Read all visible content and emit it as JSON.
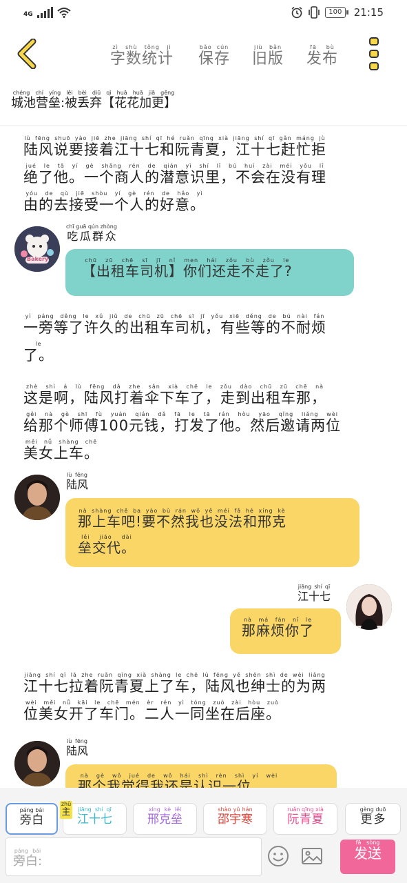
{
  "status_bar": {
    "network": "4G",
    "battery": "100",
    "time": "21:15"
  },
  "toolbar": {
    "items": [
      {
        "label": "字数统计",
        "pinyin": "zì shù tǒng jì"
      },
      {
        "label": "保存",
        "pinyin": "bǎo cún"
      },
      {
        "label": "旧版",
        "pinyin": "jiù bǎn"
      },
      {
        "label": "发布",
        "pinyin": "fā bù"
      }
    ]
  },
  "story": {
    "title": "城池营垒:被丢弃【花花加更】",
    "title_pinyin": "chéng chí yíng lěi   bèi diū qì    huā huā jiā gēng"
  },
  "messages": [
    {
      "type": "narration",
      "lines": [
        {
          "text": "陆风说要接着江十七和阮青夏，江十七赶忙拒",
          "pinyin": "lù fēng shuō yào jiē zhe jiāng shí qī hé ruǎn qīng xià  jiāng shí qī gǎn máng jù"
        },
        {
          "text": "绝了他。一个商人的潜意识里，不会在没有理",
          "pinyin": "jué le tā  yí gè shāng rén de qián yì shí lǐ  bú huì zài méi yǒu lǐ"
        },
        {
          "text": "由的去接受一个人的好意。",
          "pinyin": "yóu de qù jiē shòu yí gè rén de hǎo yì"
        }
      ]
    },
    {
      "type": "dialog",
      "side": "left",
      "speaker": "吃瓜群众",
      "speaker_pinyin": "chī guā qún zhòng",
      "color": "#7fd3cb",
      "lines": [
        {
          "text": "【出租车司机】你们还走不走了?",
          "pinyin": "chū zū chē sī jī  nǐ men hái zǒu bù zǒu le"
        }
      ]
    },
    {
      "type": "narration",
      "lines": [
        {
          "text": "一旁等了许久的出租车司机，有些等的不耐烦",
          "pinyin": "yì páng děng le xǔ jiǔ de chū zū chē sī jī  yǒu xiē děng de bú nài fán"
        },
        {
          "text": "了。",
          "pinyin": "le"
        }
      ]
    },
    {
      "type": "narration",
      "lines": [
        {
          "text": "这是啊，陆风打着伞下车了，走到出租车那，",
          "pinyin": "zhè shì á  lù fēng dǎ zhe sǎn xià chē le  zǒu dào chū zū chē nà"
        },
        {
          "text": "给那个师傅100元钱，打发了他。然后邀请两位",
          "pinyin": "gěi nà gè shī fù   yuán qián  dǎ fā le tā  rán hòu yāo qǐng liǎng wèi"
        },
        {
          "text": "美女上车。",
          "pinyin": "měi nǚ shàng chē"
        }
      ]
    },
    {
      "type": "dialog",
      "side": "left",
      "speaker": "陆风",
      "speaker_pinyin": "lù fēng",
      "color": "#fad667",
      "lines": [
        {
          "text": "那上车吧!要不然我也没法和邢克",
          "pinyin": "nà shàng chē ba  yào bù rán wǒ yě méi fǎ hé xíng kè"
        },
        {
          "text": "垒交代。",
          "pinyin": "lěi jiāo dài"
        }
      ]
    },
    {
      "type": "dialog",
      "side": "right",
      "speaker": "江十七",
      "speaker_pinyin": "jiāng shí qī",
      "color": "#fad667",
      "lines": [
        {
          "text": "那麻烦你了",
          "pinyin": "nà má fán nǐ le"
        }
      ]
    },
    {
      "type": "narration",
      "lines": [
        {
          "text": "江十七拉着阮青夏上了车，陆风也绅士的为两",
          "pinyin": "jiāng shí qī lā zhe ruǎn qīng xià shàng le chē  lù fēng yě shēn shì de wèi liǎng"
        },
        {
          "text": "位美女开了车门。二人一同坐在后座。",
          "pinyin": "wèi měi nǚ kāi le chē mén  èr rén yì tóng zuò zài hòu zuò"
        }
      ]
    },
    {
      "type": "dialog",
      "side": "left",
      "speaker": "陆风",
      "speaker_pinyin": "lù fēng",
      "color": "#fad667",
      "lines": [
        {
          "text": "那个我觉得我还是认识一位……",
          "pinyin": "nà gè wǒ jué de wǒ hái shì rèn shì yí wèi"
        }
      ]
    }
  ],
  "roles": [
    {
      "label": "旁白",
      "pinyin": "páng bái",
      "color": "#333333",
      "selected": true
    },
    {
      "label": "江十七",
      "pinyin": "jiāng shí qī",
      "color": "#3bb7c9",
      "selected": false
    },
    {
      "label": "邢克垒",
      "pinyin": "xíng kè lěi",
      "color": "#a36ad9",
      "selected": false
    },
    {
      "label": "邵宇寒",
      "pinyin": "shào yǔ hán",
      "color": "#e0453a",
      "selected": false
    },
    {
      "label": "阮青夏",
      "pinyin": "ruǎn qīng xià",
      "color": "#e64b8f",
      "selected": false
    },
    {
      "label": "更多",
      "pinyin": "gèng duō",
      "color": "#333333",
      "selected": false
    }
  ],
  "host_tag": {
    "label": "主",
    "pinyin": "zhǔ"
  },
  "composer": {
    "placeholder": "旁白:",
    "placeholder_pinyin": "páng bái",
    "send_label": "发送",
    "send_pinyin": "fā sòng"
  },
  "avatar_texts": {
    "group": "Bakery"
  }
}
